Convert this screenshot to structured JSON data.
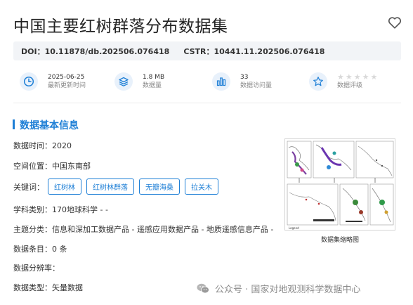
{
  "header": {
    "title": "中国主要红树群落分布数据集"
  },
  "identifiers": {
    "doi": "DOI：10.11878/db.202506.076418",
    "cstr": "CSTR：10441.11.202506.076418"
  },
  "stats": {
    "update_date": "2025-06-25",
    "update_label": "最新更新时间",
    "data_size": "1.8 MB",
    "data_size_label": "数据量",
    "visits": "33",
    "visits_label": "数据访问量",
    "rating_label": "数据评级",
    "rating_value": 0,
    "rating_max": 5
  },
  "section": {
    "title": "数据基本信息"
  },
  "info": {
    "time": "数据时间：2020",
    "location": "空间位置：中国东南部",
    "keywords_label": "关键词：",
    "keywords": [
      "红树林",
      "红树林群落",
      "无瓣海桑",
      "拉关木"
    ],
    "subject": "学科类别：170地球科学 - -",
    "topic": "主题分类：信息和深加工数据产品 - 遥感应用数据产品 - 地质遥感信息产品 -",
    "records": "数据条目：0 条",
    "resolution": "数据分辨率：",
    "type": "数据类型：矢量数据"
  },
  "thumbnail": {
    "caption": "数据集缩略图"
  },
  "watermark": {
    "text": "公众号 · 国家对地观测科学数据中心"
  },
  "colors": {
    "accent": "#1e7fd6",
    "icon_bg": "#e8f1fb",
    "doi_bg": "#f2f4f7",
    "star_empty": "#d9d9d9"
  }
}
